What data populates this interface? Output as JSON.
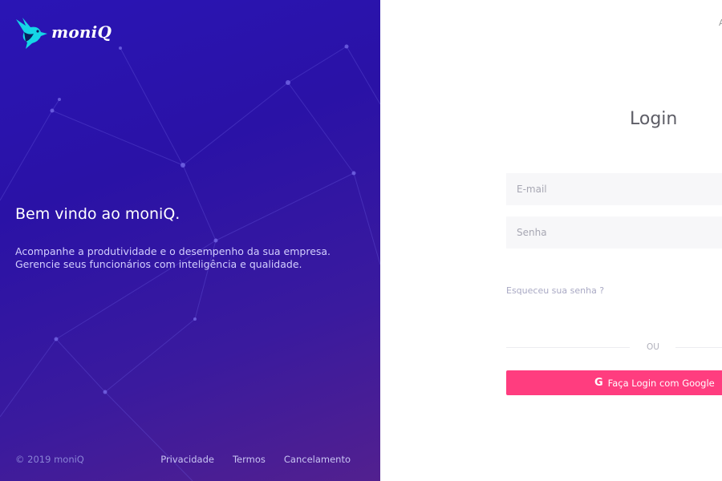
{
  "brand": {
    "name": "moniQ"
  },
  "welcome": {
    "title": "Bem vindo ao moniQ.",
    "line1": "Acompanhe a produtividade e o desempenho da sua empresa.",
    "line2": "Gerencie seus funcionários com inteligência e qualidade."
  },
  "footer": {
    "copyright": "© 2019 moniQ",
    "links": [
      "Privacidade",
      "Termos",
      "Cancelamento"
    ]
  },
  "login": {
    "title": "Login",
    "email_placeholder": "E-mail",
    "password_placeholder": "Senha",
    "forgot": "Esqueceu sua senha ?",
    "or": "OU",
    "google_label": "Faça Login com Google",
    "google_icon": "google-icon",
    "corner_text": "A"
  },
  "colors": {
    "accent": "#ff3d7f",
    "panel_start": "#2a15b5",
    "panel_end": "#52208f"
  }
}
